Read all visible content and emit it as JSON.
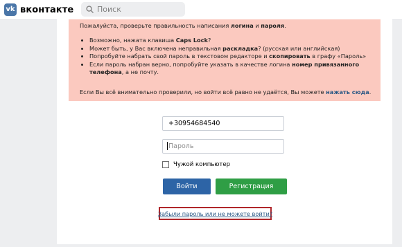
{
  "header": {
    "logo_text": "вконтакте",
    "logo_mark": "vk",
    "search_placeholder": "Поиск"
  },
  "alert": {
    "intro_prefix": "Пожалуйста, проверьте правильность написания ",
    "intro_b1": "логина",
    "intro_mid": " и ",
    "intro_b2": "пароля",
    "intro_suffix": ".",
    "items": [
      {
        "pre": "Возможно, нажата клавиша ",
        "bold": "Caps Lock",
        "post": "?"
      },
      {
        "pre": "Может быть, у Вас включена неправильная ",
        "bold": "раскладка",
        "post": "? (русская или английская)"
      },
      {
        "pre": "Попробуйте набрать свой пароль в текстовом редакторе и ",
        "bold": "скопировать",
        "post": " в графу «Пароль»"
      },
      {
        "pre": "Если пароль набран верно, попробуйте указать в качестве логина ",
        "bold": "номер привязанного телефона",
        "post": ", а не почту."
      }
    ],
    "outro_text": "Если Вы всё внимательно проверили, но войти всё равно не удаётся, Вы можете ",
    "outro_link": "нажать сюда",
    "outro_suffix": "."
  },
  "form": {
    "phone_value": "+30954684540",
    "password_placeholder": "Пароль",
    "remember_label": "Чужой компьютер",
    "login_button": "Войти",
    "register_button": "Регистрация",
    "forgot_link": "Забыли пароль или не можете войти?"
  },
  "colors": {
    "brand": "#4a76a8",
    "alert_bg": "#fbc9bf",
    "login_button": "#2d64a6",
    "register_button": "#2f9e45",
    "highlight_border": "#b0262b"
  }
}
